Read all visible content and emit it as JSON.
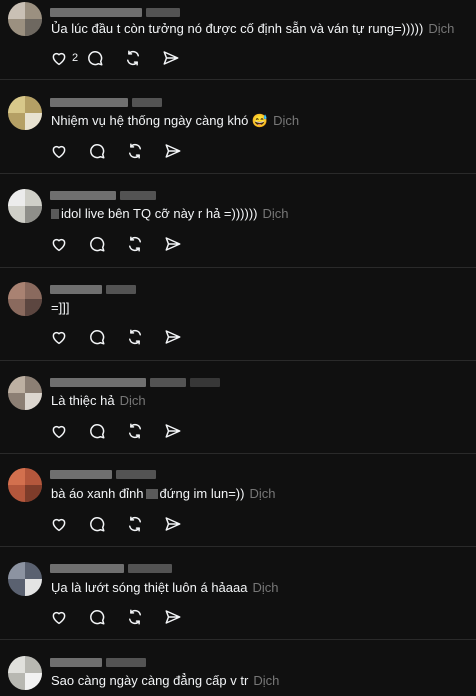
{
  "comments": [
    {
      "text": "Ủa lúc đầu t còn tưởng nó được cố định sẵn và ván tự rung=)))))",
      "translate_label": "Dịch",
      "like_count": "2"
    },
    {
      "text": "Nhiệm vụ hệ thống ngày càng khó 😅",
      "translate_label": "Dịch",
      "like_count": ""
    },
    {
      "text": "idol live bên TQ cỡ này r hả =))))))",
      "translate_label": "Dịch",
      "like_count": ""
    },
    {
      "text": "=]]]",
      "translate_label": "",
      "like_count": ""
    },
    {
      "text": "Là thiệc hả",
      "translate_label": "Dịch",
      "like_count": ""
    },
    {
      "text_before": "bà áo xanh đỉnh",
      "text_after": "đứng im lun=))",
      "translate_label": "Dịch",
      "like_count": ""
    },
    {
      "text": "Ụa là lướt sóng thiệt luôn á hảaaa",
      "translate_label": "Dịch",
      "like_count": ""
    },
    {
      "text": "Sao càng ngày càng đẳng cấp v tr",
      "translate_label": "Dịch",
      "like_count": ""
    }
  ],
  "icons": {
    "like": "heart-icon",
    "reply": "comment-icon",
    "repost": "repost-icon",
    "share": "send-icon"
  },
  "colors": {
    "background": "#101010",
    "text": "#f3f5f7",
    "muted": "#777777",
    "divider": "#2a2a2a"
  }
}
